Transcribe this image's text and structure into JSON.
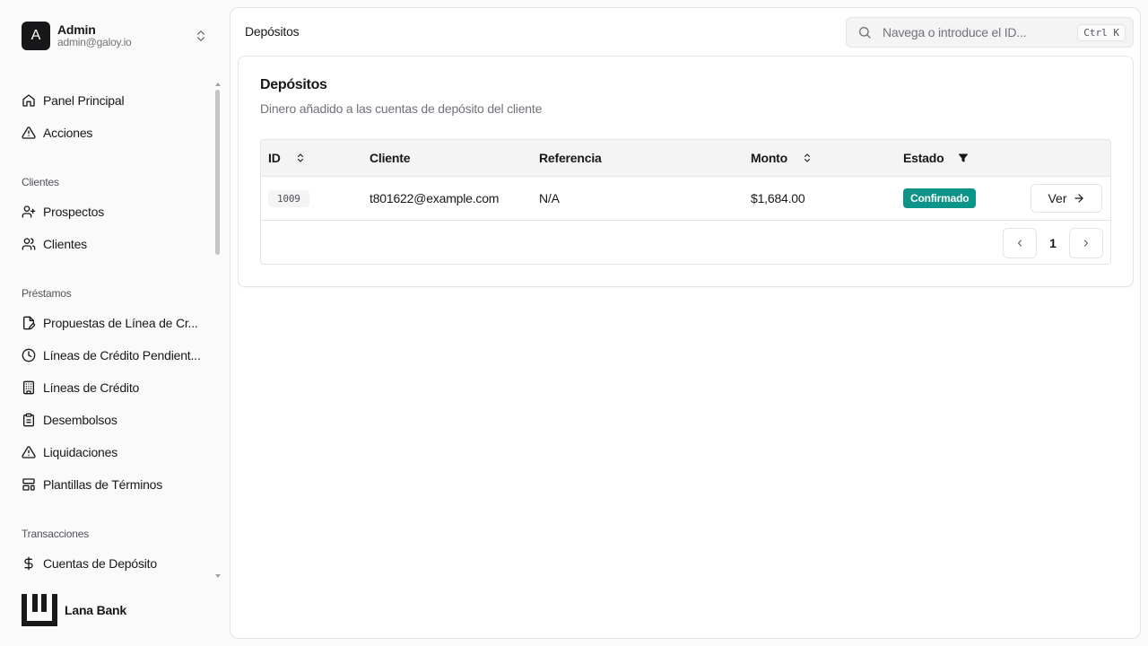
{
  "user": {
    "initial": "A",
    "name": "Admin",
    "email": "admin@galoy.io"
  },
  "sidebar": {
    "main_items": [
      {
        "label": "Panel Principal",
        "icon": "home-icon"
      },
      {
        "label": "Acciones",
        "icon": "alert-triangle-icon"
      }
    ],
    "clients_label": "Clientes",
    "clients_items": [
      {
        "label": "Prospectos",
        "icon": "user-plus-icon"
      },
      {
        "label": "Clientes",
        "icon": "users-icon"
      }
    ],
    "loans_label": "Préstamos",
    "loans_items": [
      {
        "label": "Propuestas de Línea de Cr...",
        "icon": "file-edit-icon"
      },
      {
        "label": "Líneas de Crédito Pendient...",
        "icon": "clock-icon"
      },
      {
        "label": "Líneas de Crédito",
        "icon": "building-icon"
      },
      {
        "label": "Desembolsos",
        "icon": "clipboard-icon"
      },
      {
        "label": "Liquidaciones",
        "icon": "alert-triangle-icon"
      },
      {
        "label": "Plantillas de Términos",
        "icon": "layout-template-icon"
      }
    ],
    "transactions_label": "Transacciones",
    "transactions_items": [
      {
        "label": "Cuentas de Depósito",
        "icon": "dollar-icon"
      }
    ]
  },
  "brand": {
    "name": "Lana Bank"
  },
  "header": {
    "breadcrumb": "Depósitos",
    "search_placeholder": "Navega o introduce el ID...",
    "search_shortcut": "Ctrl K"
  },
  "card": {
    "title": "Depósitos",
    "description": "Dinero añadido a las cuentas de depósito del cliente"
  },
  "table": {
    "columns": [
      "ID",
      "Cliente",
      "Referencia",
      "Monto",
      "Estado"
    ],
    "rows": [
      {
        "id": "1009",
        "client": "t801622@example.com",
        "reference": "N/A",
        "amount": "$1,684.00",
        "status": "Confirmado",
        "action": "Ver"
      }
    ],
    "page": "1"
  },
  "colors": {
    "status_confirmed": "#0d9488",
    "accent": "#18181b"
  }
}
